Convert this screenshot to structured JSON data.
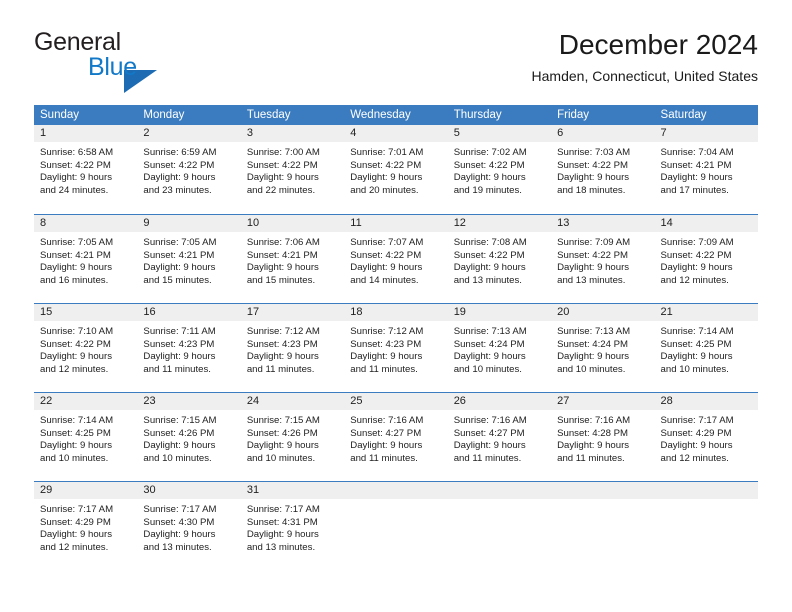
{
  "logo": {
    "word_top": "General",
    "word_bottom": "Blue",
    "triangle_color": "#1d6cb3",
    "blue_color": "#1278c8"
  },
  "header": {
    "title": "December 2024",
    "subtitle": "Hamden, Connecticut, United States"
  },
  "theme": {
    "header_blue": "#3b7cc0",
    "day_band_gray": "#efefef",
    "text": "#222222"
  },
  "weekdays": [
    "Sunday",
    "Monday",
    "Tuesday",
    "Wednesday",
    "Thursday",
    "Friday",
    "Saturday"
  ],
  "weeks": [
    [
      {
        "day": "1",
        "sunrise": "Sunrise: 6:58 AM",
        "sunset": "Sunset: 4:22 PM",
        "daylight1": "Daylight: 9 hours",
        "daylight2": "and 24 minutes."
      },
      {
        "day": "2",
        "sunrise": "Sunrise: 6:59 AM",
        "sunset": "Sunset: 4:22 PM",
        "daylight1": "Daylight: 9 hours",
        "daylight2": "and 23 minutes."
      },
      {
        "day": "3",
        "sunrise": "Sunrise: 7:00 AM",
        "sunset": "Sunset: 4:22 PM",
        "daylight1": "Daylight: 9 hours",
        "daylight2": "and 22 minutes."
      },
      {
        "day": "4",
        "sunrise": "Sunrise: 7:01 AM",
        "sunset": "Sunset: 4:22 PM",
        "daylight1": "Daylight: 9 hours",
        "daylight2": "and 20 minutes."
      },
      {
        "day": "5",
        "sunrise": "Sunrise: 7:02 AM",
        "sunset": "Sunset: 4:22 PM",
        "daylight1": "Daylight: 9 hours",
        "daylight2": "and 19 minutes."
      },
      {
        "day": "6",
        "sunrise": "Sunrise: 7:03 AM",
        "sunset": "Sunset: 4:22 PM",
        "daylight1": "Daylight: 9 hours",
        "daylight2": "and 18 minutes."
      },
      {
        "day": "7",
        "sunrise": "Sunrise: 7:04 AM",
        "sunset": "Sunset: 4:21 PM",
        "daylight1": "Daylight: 9 hours",
        "daylight2": "and 17 minutes."
      }
    ],
    [
      {
        "day": "8",
        "sunrise": "Sunrise: 7:05 AM",
        "sunset": "Sunset: 4:21 PM",
        "daylight1": "Daylight: 9 hours",
        "daylight2": "and 16 minutes."
      },
      {
        "day": "9",
        "sunrise": "Sunrise: 7:05 AM",
        "sunset": "Sunset: 4:21 PM",
        "daylight1": "Daylight: 9 hours",
        "daylight2": "and 15 minutes."
      },
      {
        "day": "10",
        "sunrise": "Sunrise: 7:06 AM",
        "sunset": "Sunset: 4:21 PM",
        "daylight1": "Daylight: 9 hours",
        "daylight2": "and 15 minutes."
      },
      {
        "day": "11",
        "sunrise": "Sunrise: 7:07 AM",
        "sunset": "Sunset: 4:22 PM",
        "daylight1": "Daylight: 9 hours",
        "daylight2": "and 14 minutes."
      },
      {
        "day": "12",
        "sunrise": "Sunrise: 7:08 AM",
        "sunset": "Sunset: 4:22 PM",
        "daylight1": "Daylight: 9 hours",
        "daylight2": "and 13 minutes."
      },
      {
        "day": "13",
        "sunrise": "Sunrise: 7:09 AM",
        "sunset": "Sunset: 4:22 PM",
        "daylight1": "Daylight: 9 hours",
        "daylight2": "and 13 minutes."
      },
      {
        "day": "14",
        "sunrise": "Sunrise: 7:09 AM",
        "sunset": "Sunset: 4:22 PM",
        "daylight1": "Daylight: 9 hours",
        "daylight2": "and 12 minutes."
      }
    ],
    [
      {
        "day": "15",
        "sunrise": "Sunrise: 7:10 AM",
        "sunset": "Sunset: 4:22 PM",
        "daylight1": "Daylight: 9 hours",
        "daylight2": "and 12 minutes."
      },
      {
        "day": "16",
        "sunrise": "Sunrise: 7:11 AM",
        "sunset": "Sunset: 4:23 PM",
        "daylight1": "Daylight: 9 hours",
        "daylight2": "and 11 minutes."
      },
      {
        "day": "17",
        "sunrise": "Sunrise: 7:12 AM",
        "sunset": "Sunset: 4:23 PM",
        "daylight1": "Daylight: 9 hours",
        "daylight2": "and 11 minutes."
      },
      {
        "day": "18",
        "sunrise": "Sunrise: 7:12 AM",
        "sunset": "Sunset: 4:23 PM",
        "daylight1": "Daylight: 9 hours",
        "daylight2": "and 11 minutes."
      },
      {
        "day": "19",
        "sunrise": "Sunrise: 7:13 AM",
        "sunset": "Sunset: 4:24 PM",
        "daylight1": "Daylight: 9 hours",
        "daylight2": "and 10 minutes."
      },
      {
        "day": "20",
        "sunrise": "Sunrise: 7:13 AM",
        "sunset": "Sunset: 4:24 PM",
        "daylight1": "Daylight: 9 hours",
        "daylight2": "and 10 minutes."
      },
      {
        "day": "21",
        "sunrise": "Sunrise: 7:14 AM",
        "sunset": "Sunset: 4:25 PM",
        "daylight1": "Daylight: 9 hours",
        "daylight2": "and 10 minutes."
      }
    ],
    [
      {
        "day": "22",
        "sunrise": "Sunrise: 7:14 AM",
        "sunset": "Sunset: 4:25 PM",
        "daylight1": "Daylight: 9 hours",
        "daylight2": "and 10 minutes."
      },
      {
        "day": "23",
        "sunrise": "Sunrise: 7:15 AM",
        "sunset": "Sunset: 4:26 PM",
        "daylight1": "Daylight: 9 hours",
        "daylight2": "and 10 minutes."
      },
      {
        "day": "24",
        "sunrise": "Sunrise: 7:15 AM",
        "sunset": "Sunset: 4:26 PM",
        "daylight1": "Daylight: 9 hours",
        "daylight2": "and 10 minutes."
      },
      {
        "day": "25",
        "sunrise": "Sunrise: 7:16 AM",
        "sunset": "Sunset: 4:27 PM",
        "daylight1": "Daylight: 9 hours",
        "daylight2": "and 11 minutes."
      },
      {
        "day": "26",
        "sunrise": "Sunrise: 7:16 AM",
        "sunset": "Sunset: 4:27 PM",
        "daylight1": "Daylight: 9 hours",
        "daylight2": "and 11 minutes."
      },
      {
        "day": "27",
        "sunrise": "Sunrise: 7:16 AM",
        "sunset": "Sunset: 4:28 PM",
        "daylight1": "Daylight: 9 hours",
        "daylight2": "and 11 minutes."
      },
      {
        "day": "28",
        "sunrise": "Sunrise: 7:17 AM",
        "sunset": "Sunset: 4:29 PM",
        "daylight1": "Daylight: 9 hours",
        "daylight2": "and 12 minutes."
      }
    ],
    [
      {
        "day": "29",
        "sunrise": "Sunrise: 7:17 AM",
        "sunset": "Sunset: 4:29 PM",
        "daylight1": "Daylight: 9 hours",
        "daylight2": "and 12 minutes."
      },
      {
        "day": "30",
        "sunrise": "Sunrise: 7:17 AM",
        "sunset": "Sunset: 4:30 PM",
        "daylight1": "Daylight: 9 hours",
        "daylight2": "and 13 minutes."
      },
      {
        "day": "31",
        "sunrise": "Sunrise: 7:17 AM",
        "sunset": "Sunset: 4:31 PM",
        "daylight1": "Daylight: 9 hours",
        "daylight2": "and 13 minutes."
      },
      {
        "day": "",
        "sunrise": "",
        "sunset": "",
        "daylight1": "",
        "daylight2": ""
      },
      {
        "day": "",
        "sunrise": "",
        "sunset": "",
        "daylight1": "",
        "daylight2": ""
      },
      {
        "day": "",
        "sunrise": "",
        "sunset": "",
        "daylight1": "",
        "daylight2": ""
      },
      {
        "day": "",
        "sunrise": "",
        "sunset": "",
        "daylight1": "",
        "daylight2": ""
      }
    ]
  ]
}
